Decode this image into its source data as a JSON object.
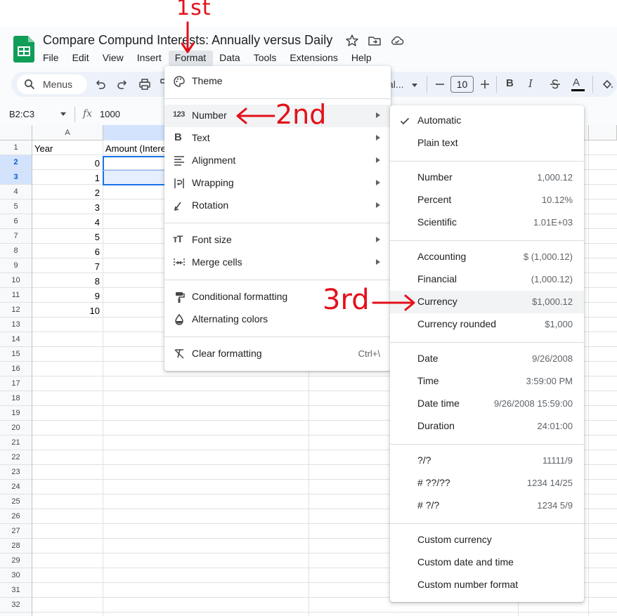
{
  "app": {
    "doc_title": "Compare Compund Interests: Annually versus Daily",
    "menus": [
      "File",
      "Edit",
      "View",
      "Insert",
      "Format",
      "Data",
      "Tools",
      "Extensions",
      "Help"
    ],
    "active_menu": "Format"
  },
  "toolbar": {
    "search_placeholder": "Menus",
    "font_truncated": "al...",
    "font_size": "10"
  },
  "formula_bar": {
    "name_box": "B2:C3",
    "fx": "fx",
    "value": "1000"
  },
  "sheet": {
    "columns": [
      "A"
    ],
    "rows": [
      "1",
      "2",
      "3",
      "4",
      "5",
      "6",
      "7",
      "8",
      "9",
      "10",
      "11",
      "12",
      "13",
      "14",
      "15",
      "16",
      "17",
      "18",
      "19",
      "20",
      "21",
      "22",
      "23",
      "24",
      "25",
      "26",
      "27",
      "28",
      "29",
      "30",
      "31",
      "32"
    ],
    "a1": "Year",
    "b1": "Amount (Intere",
    "years": [
      "0",
      "1",
      "2",
      "3",
      "4",
      "5",
      "6",
      "7",
      "8",
      "9",
      "10"
    ]
  },
  "format_menu": {
    "items": [
      {
        "label": "Theme",
        "icon": "palette-icon"
      },
      {
        "label": "Number",
        "icon": "number-123-icon",
        "submenu": true
      },
      {
        "label": "Text",
        "icon": "bold-icon",
        "submenu": true
      },
      {
        "label": "Alignment",
        "icon": "align-icon",
        "submenu": true
      },
      {
        "label": "Wrapping",
        "icon": "wrap-icon",
        "submenu": true
      },
      {
        "label": "Rotation",
        "icon": "rotation-icon",
        "submenu": true
      },
      {
        "label": "Font size",
        "icon": "font-size-icon",
        "submenu": true
      },
      {
        "label": "Merge cells",
        "icon": "merge-icon",
        "submenu": true
      },
      {
        "label": "Conditional formatting",
        "icon": "paint-roller-icon"
      },
      {
        "label": "Alternating colors",
        "icon": "drop-icon"
      },
      {
        "label": "Clear formatting",
        "icon": "clear-format-icon",
        "shortcut": "Ctrl+\\"
      }
    ]
  },
  "number_submenu": {
    "items": [
      {
        "label": "Automatic",
        "example": "",
        "checked": true
      },
      {
        "label": "Plain text",
        "example": ""
      },
      {
        "label": "Number",
        "example": "1,000.12"
      },
      {
        "label": "Percent",
        "example": "10.12%"
      },
      {
        "label": "Scientific",
        "example": "1.01E+03"
      },
      {
        "label": "Accounting",
        "example": "$ (1,000.12)"
      },
      {
        "label": "Financial",
        "example": "(1,000.12)"
      },
      {
        "label": "Currency",
        "example": "$1,000.12"
      },
      {
        "label": "Currency rounded",
        "example": "$1,000"
      },
      {
        "label": "Date",
        "example": "9/26/2008"
      },
      {
        "label": "Time",
        "example": "3:59:00 PM"
      },
      {
        "label": "Date time",
        "example": "9/26/2008 15:59:00"
      },
      {
        "label": "Duration",
        "example": "24:01:00"
      },
      {
        "label": "?/?",
        "example": "11111/9"
      },
      {
        "label": "# ??/??",
        "example": "1234 14/25"
      },
      {
        "label": "# ?/?",
        "example": "1234 5/9"
      },
      {
        "label": "Custom currency",
        "example": ""
      },
      {
        "label": "Custom date and time",
        "example": ""
      },
      {
        "label": "Custom number format",
        "example": ""
      }
    ]
  },
  "annotations": {
    "first": "1st",
    "second": "2nd",
    "third": "3rd"
  },
  "colors": {
    "accent": "#1a73e8",
    "annotation": "#e3101a",
    "sheets_green": "#0f9d58"
  }
}
